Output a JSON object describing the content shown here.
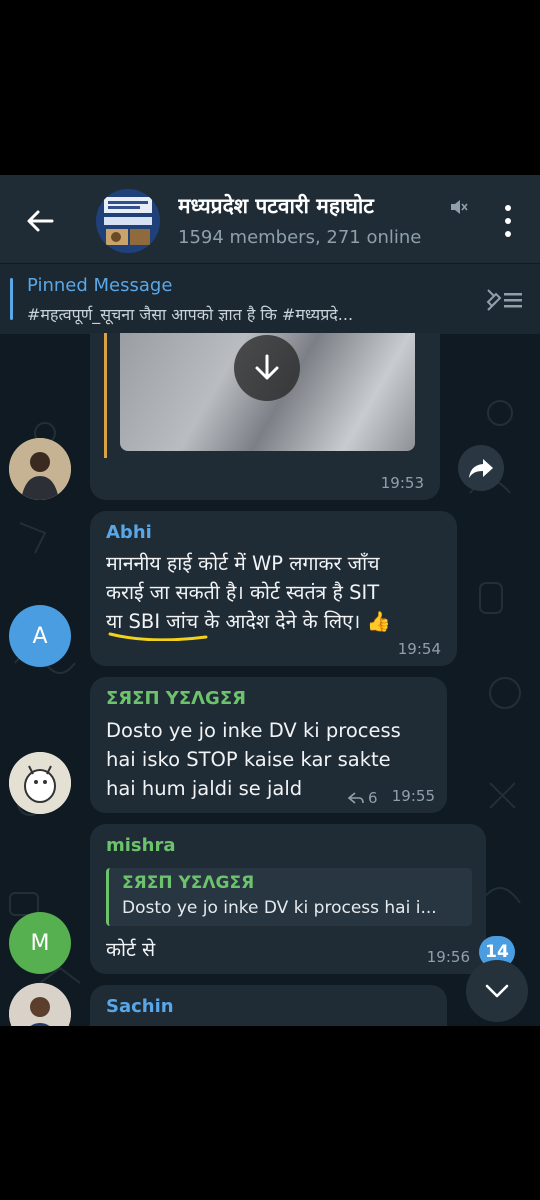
{
  "header": {
    "title": "मध्यप्रदेश पटवारी महाघोट",
    "subtitle": "1594 members, 271 online",
    "back_icon": "arrow-left-icon",
    "mute_icon": "muted-speaker-icon",
    "menu_icon": "more-vertical-icon"
  },
  "pinned": {
    "title": "Pinned Message",
    "text": "#महत्वपूर्ण_सूचना जैसा आपको ज्ञात है कि #मध्यप्रदे..."
  },
  "messages": {
    "m1": {
      "time": "19:53",
      "media_icon": "download-icon",
      "forward_icon": "share-icon"
    },
    "m2": {
      "sender": "Abhi",
      "sender_color": "#5aa7e8",
      "line1": "माननीय हाई कोर्ट में WP लगाकर जाँच",
      "line2": "कराई जा सकती है। कोर्ट स्वतंत्र है SIT",
      "line3": "या SBI जांच के आदेश देने के लिए। 👍",
      "time": "19:54",
      "avatar_letter": "A"
    },
    "m3": {
      "sender": "ΣЯΣП ΥΣΛGΣЯ",
      "sender_color": "#6cc36c",
      "line1": "Dosto ye jo inke DV ki process",
      "line2": "hai isko STOP kaise kar sakte",
      "line3": "hai hum jaldi se jald",
      "replies": "6",
      "time": "19:55"
    },
    "m4": {
      "sender": "mishra",
      "sender_color": "#6cc36c",
      "reply_sender": "ΣЯΣП ΥΣΛGΣЯ",
      "reply_text": "Dosto ye jo inke DV ki process hai i...",
      "text": "कोर्ट से",
      "time": "19:56",
      "avatar_letter": "M"
    },
    "m5": {
      "sender": "Sachin",
      "sender_color": "#5aa7e8"
    }
  },
  "unread_count": "14",
  "colors": {
    "bg": "#0f1a22",
    "bubble": "#1f2c36",
    "accent": "#5aa7e8",
    "header": "#1f2c36"
  }
}
